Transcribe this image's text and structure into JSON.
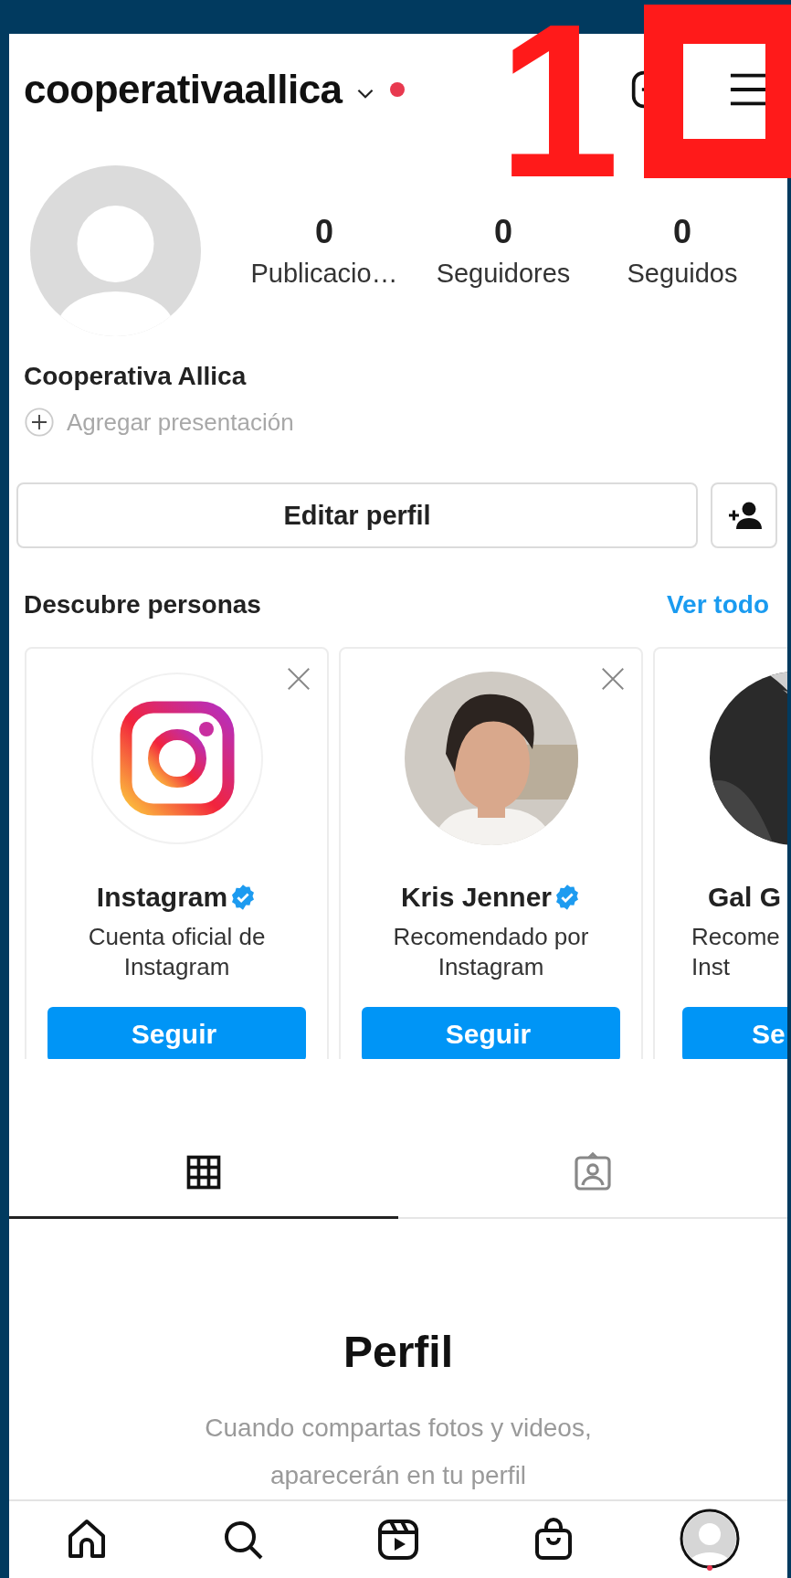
{
  "header": {
    "username": "cooperativaallica",
    "new_activity": true
  },
  "overlay": {
    "step_number": "1"
  },
  "profile": {
    "stats": [
      {
        "value": "0",
        "label": "Publicacio…"
      },
      {
        "value": "0",
        "label": "Seguidores"
      },
      {
        "value": "0",
        "label": "Seguidos"
      }
    ],
    "name": "Cooperativa Allica",
    "bio_placeholder": "Agregar presentación"
  },
  "edit_button": "Editar perfil",
  "discover": {
    "title": "Descubre personas",
    "see_all": "Ver todo",
    "cards": [
      {
        "kind": "full",
        "avatar": {
          "kind": "logo"
        },
        "name": "Instagram",
        "verified": true,
        "subtitle_lines": [
          "Cuenta oficial de",
          "Instagram"
        ],
        "button": "Seguir",
        "dismissable": true
      },
      {
        "kind": "full",
        "avatar": {
          "kind": "picture"
        },
        "name": "Kris Jenner",
        "verified": true,
        "subtitle_lines": [
          "Recomendado por",
          "Instagram"
        ],
        "button": "Seguir",
        "dismissable": true
      },
      {
        "kind": "partial",
        "avatar": {
          "kind": "picture"
        },
        "name": "Gal G",
        "verified": false,
        "subtitle_lines": [
          "Recome",
          "Inst"
        ],
        "button": "Se",
        "dismissable": false
      }
    ]
  },
  "tabs": [
    {
      "kind": "grid",
      "selected": true
    },
    {
      "kind": "tagged",
      "selected": false
    }
  ],
  "empty_state": {
    "title": "Perfil",
    "text_lines": [
      "Cuando compartas fotos y videos,",
      "aparecerán en tu perfil"
    ]
  },
  "bottom_nav": [
    {
      "kind": "home"
    },
    {
      "kind": "search"
    },
    {
      "kind": "reels"
    },
    {
      "kind": "shop"
    },
    {
      "kind": "profile"
    }
  ]
}
